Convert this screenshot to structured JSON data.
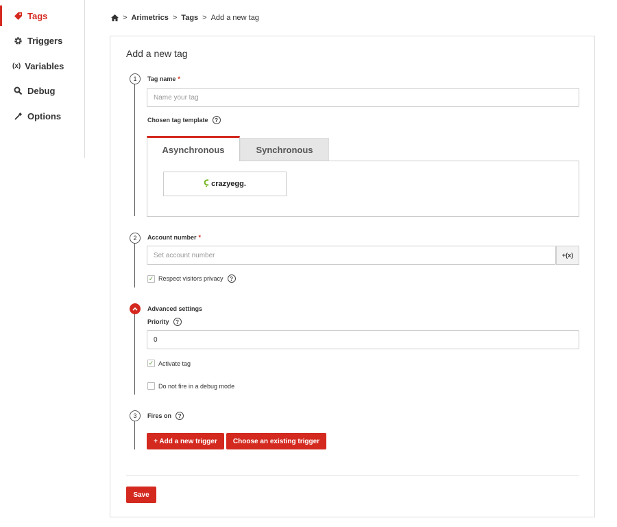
{
  "sidebar": {
    "items": [
      {
        "label": "Tags",
        "icon": "tag-icon"
      },
      {
        "label": "Triggers",
        "icon": "gear-icon"
      },
      {
        "label": "Variables",
        "icon_text": "(x)"
      },
      {
        "label": "Debug",
        "icon": "search-icon"
      },
      {
        "label": "Options",
        "icon": "wrench-icon"
      }
    ]
  },
  "breadcrumb": {
    "separator": ">",
    "items": [
      "Arimetrics",
      "Tags",
      "Add a new tag"
    ]
  },
  "card": {
    "title": "Add a new tag"
  },
  "step1": {
    "number": "1",
    "tag_name_label": "Tag name",
    "required_mark": "*",
    "tag_name_placeholder": "Name your tag",
    "template_label": "Chosen tag template",
    "tabs": [
      "Asynchronous",
      "Synchronous"
    ],
    "template_name": "crazyegg."
  },
  "step2": {
    "number": "2",
    "account_label": "Account number",
    "account_placeholder": "Set account number",
    "variable_button": "+(x)",
    "privacy_label": "Respect visitors privacy",
    "privacy_checked": true
  },
  "advanced": {
    "title": "Advanced settings",
    "priority_label": "Priority",
    "priority_value": "0",
    "activate_label": "Activate tag",
    "activate_checked": true,
    "debug_label": "Do not fire in a debug mode",
    "debug_checked": false
  },
  "step3": {
    "number": "3",
    "fires_label": "Fires on",
    "add_trigger": "+ Add a new trigger",
    "choose_trigger": "Choose an existing trigger"
  },
  "save_label": "Save",
  "help_glyph": "?",
  "colors": {
    "accent": "#d4291f",
    "check": "#5a9a3a",
    "crazyegg_green": "#7ab828"
  }
}
